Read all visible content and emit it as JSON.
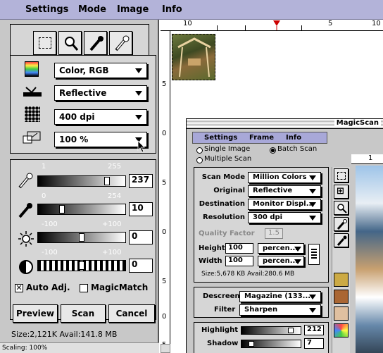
{
  "menubar": {
    "settings": "Settings",
    "mode": "Mode",
    "image": "Image",
    "info": "Info"
  },
  "main": {
    "tools": [
      "marquee-icon",
      "zoom-icon",
      "eyedropper-icon",
      "eyedropper-white-icon"
    ],
    "mode_value": "Color, RGB",
    "scan_type_value": "Reflective",
    "resolution_value": "400 dpi",
    "scale_value": "100 %",
    "highlight": {
      "min": "1",
      "max": "255",
      "value": "237"
    },
    "shadow": {
      "min": "0",
      "max": "254",
      "value": "10"
    },
    "brightness": {
      "min": "-100",
      "max": "+100",
      "value": "0"
    },
    "contrast": {
      "min": "-100",
      "max": "+100",
      "value": "0"
    },
    "auto_adj_label": "Auto Adj.",
    "auto_adj_checked": true,
    "magicmatch_label": "MagicMatch",
    "magicmatch_checked": false,
    "preview_label": "Preview",
    "scan_label": "Scan",
    "cancel_label": "Cancel",
    "size_text": "Size:2,121K  Avail:141.8 MB",
    "scaling_text": "Scaling: 100%"
  },
  "ruler": {
    "labels": [
      "10",
      "5",
      "10"
    ],
    "vlabels": [
      "5",
      "0",
      "5",
      "0",
      "5",
      "0",
      "5"
    ]
  },
  "magicscan": {
    "title": "MagicScan",
    "menu": {
      "settings": "Settings",
      "frame": "Frame",
      "info": "Info"
    },
    "single_image": "Single Image",
    "batch_scan": "Batch Scan",
    "multiple_scan": "Multiple Scan",
    "scan_mode_label": "Scan Mode",
    "scan_mode_value": "Million Colors",
    "original_label": "Original",
    "original_value": "Reflective",
    "destination_label": "Destination",
    "destination_value": "Monitor Displ...",
    "resolution_label": "Resolution",
    "resolution_value": "300 dpi",
    "quality_label": "Quality Factor",
    "quality_value": "1.5",
    "height_label": "Height",
    "height_value": "100",
    "height_unit": "percen...",
    "width_label": "Width",
    "width_value": "100",
    "width_unit": "percen...",
    "size_text": "Size:5,678 KB   Avail:280.6 MB",
    "descreen_label": "Descreen",
    "descreen_value": "Magazine (133...",
    "filter_label": "Filter",
    "filter_value": "Sharpen",
    "highlight_label": "Highlight",
    "highlight_value": "212",
    "shadow_label": "Shadow",
    "shadow_value": "7",
    "ruler_label": "1"
  },
  "colors": {
    "menubar": "#b3b3d9",
    "panel": "#c8c8c8",
    "accent": "#8888bb"
  }
}
